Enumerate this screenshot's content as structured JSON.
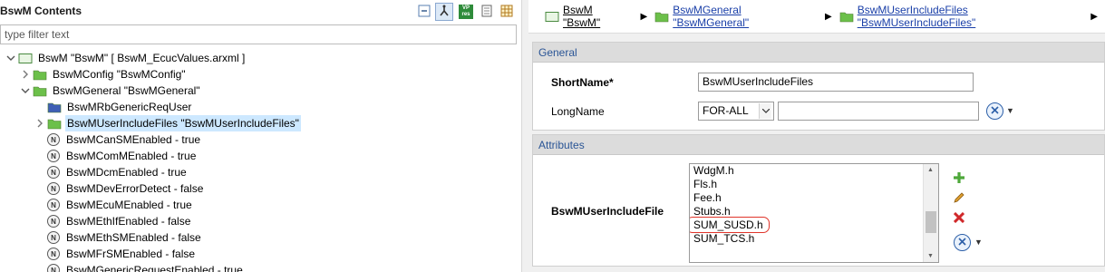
{
  "left": {
    "title": "BswM Contents",
    "filter_placeholder": "type filter text",
    "toolbar": {
      "vp_label_top": "VP",
      "vp_label_bottom": "res"
    },
    "tree": [
      {
        "label": "BswM \"BswM\" [ BswM_EcucValues.arxml ]",
        "icon": "module-icon",
        "arrow": "expanded"
      },
      {
        "label": "BswMConfig \"BswMConfig\"",
        "icon": "folder-icon",
        "arrow": "collapsed"
      },
      {
        "label": "BswMGeneral \"BswMGeneral\"",
        "icon": "folder-icon",
        "arrow": "expanded"
      },
      {
        "label": "BswMRbGenericReqUser",
        "icon": "blue-folder-icon",
        "arrow": "none"
      },
      {
        "label": "BswMUserIncludeFiles \"BswMUserIncludeFiles\"",
        "icon": "folder-icon",
        "arrow": "collapsed",
        "selected": true
      },
      {
        "label": "BswMCanSMEnabled - true",
        "icon": "parameter-icon",
        "arrow": "none"
      },
      {
        "label": "BswMComMEnabled - true",
        "icon": "parameter-icon",
        "arrow": "none"
      },
      {
        "label": "BswMDcmEnabled - true",
        "icon": "parameter-icon",
        "arrow": "none"
      },
      {
        "label": "BswMDevErrorDetect - false",
        "icon": "parameter-icon",
        "arrow": "none"
      },
      {
        "label": "BswMEcuMEnabled - true",
        "icon": "parameter-icon",
        "arrow": "none"
      },
      {
        "label": "BswMEthIfEnabled - false",
        "icon": "parameter-icon",
        "arrow": "none"
      },
      {
        "label": "BswMEthSMEnabled - false",
        "icon": "parameter-icon",
        "arrow": "none"
      },
      {
        "label": "BswMFrSMEnabled - false",
        "icon": "parameter-icon",
        "arrow": "none"
      },
      {
        "label": "BswMGenericRequestEnabled - true",
        "icon": "parameter-icon",
        "arrow": "none"
      }
    ],
    "param_icon_glyph": "N"
  },
  "right": {
    "breadcrumb": [
      {
        "label": "BswM \"BswM\"",
        "icon": "module-icon"
      },
      {
        "label": "BswMGeneral \"BswMGeneral\"",
        "icon": "folder-icon"
      },
      {
        "label": "BswMUserIncludeFiles \"BswMUserIncludeFiles\"",
        "icon": "folder-icon"
      }
    ],
    "general": {
      "header": "General",
      "shortname_label": "ShortName*",
      "shortname_value": "BswMUserIncludeFiles",
      "longname_label": "LongName",
      "language_value": "FOR-ALL",
      "longname_value": ""
    },
    "attributes": {
      "header": "Attributes",
      "field_label": "BswMUserIncludeFile",
      "files": [
        "WdgM.h",
        "Fls.h",
        "Fee.h",
        "Stubs.h",
        "SUM_SUSD.h",
        "SUM_TCS.h"
      ],
      "highlighted_file": "SUM_SUSD.h"
    }
  },
  "colors": {
    "folder_green": "#6cc04a",
    "folder_blue": "#3f5fb5",
    "link_blue": "#1a3fa8",
    "section_header_text": "#2a5596",
    "highlight_red": "#e0352b",
    "selection_bg": "#cde8ff"
  }
}
